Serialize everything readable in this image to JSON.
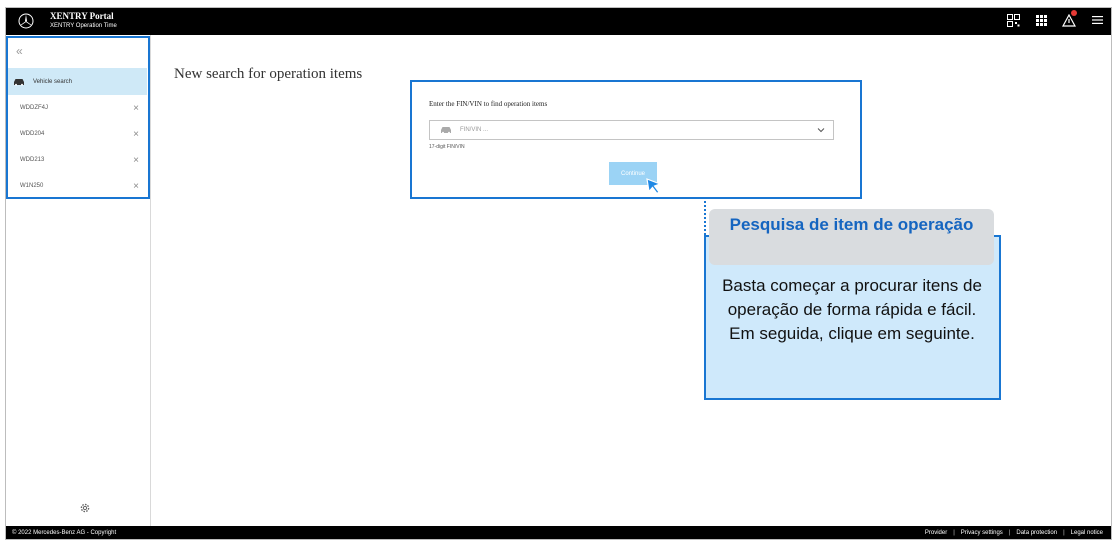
{
  "header": {
    "app_title": "XENTRY Portal",
    "app_subtitle": "XENTRY Operation Time",
    "icons": [
      "logo-icon",
      "qr-icon",
      "apps-grid-icon",
      "alert-icon",
      "menu-icon"
    ]
  },
  "sidebar": {
    "collapse_label": "«",
    "vehicle_search_label": "Vehicle search",
    "recent_items": [
      {
        "label": "WDDZF4J",
        "close": "×"
      },
      {
        "label": "WDD204",
        "close": "×"
      },
      {
        "label": "WDD213",
        "close": "×"
      },
      {
        "label": "W1N250",
        "close": "×"
      }
    ]
  },
  "main": {
    "title": "New search for operation items",
    "search": {
      "label": "Enter the FIN/VIN to find operation items",
      "placeholder": "FIN/VIN ...",
      "hint": "17-digit FIN/VIN",
      "continue_label": "Continue"
    }
  },
  "tooltip": {
    "title": "Pesquisa de item de operação",
    "body": "Basta começar a procurar itens de operação de forma rápida e fácil. Em seguida, clique em seguinte."
  },
  "footer": {
    "copyright": "© 2022 Mercedes-Benz AG - Copyright",
    "links": [
      "Provider",
      "Privacy settings",
      "Data protection",
      "Legal notice"
    ],
    "separator": "|"
  },
  "colors": {
    "highlight_blue": "#1976d2",
    "selected_bg": "#cfe9f7",
    "tooltip_bg": "#cfe9fb",
    "button_bg": "#9bd3f5",
    "alert_red": "#e53935"
  }
}
